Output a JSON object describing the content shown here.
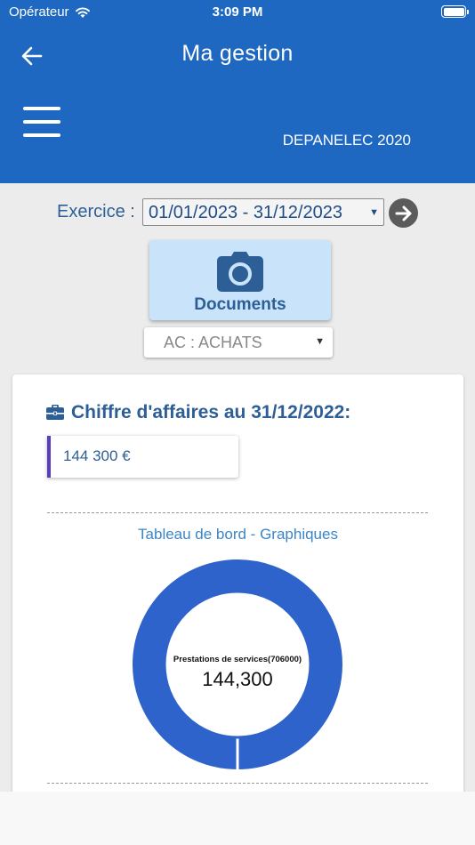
{
  "status_bar": {
    "carrier": "Opérateur",
    "time": "3:09 PM"
  },
  "header": {
    "title": "Ma gestion",
    "company": "DEPANELEC 2020"
  },
  "exercise": {
    "label": "Exercice :",
    "selected": "01/01/2023 - 31/12/2023"
  },
  "documents": {
    "label": "Documents"
  },
  "journal": {
    "selected": "AC : ACHATS"
  },
  "turnover": {
    "title": "Chiffre d'affaires au 31/12/2022:",
    "value": "144 300 €"
  },
  "dashboard": {
    "title": "Tableau de bord - Graphiques"
  },
  "chart_data": {
    "type": "pie",
    "variant": "donut",
    "series": [
      {
        "name": "Prestations de services(706000)",
        "value": 144300
      }
    ],
    "center_label": "Prestations de services(706000)",
    "center_value": "144,300"
  },
  "colors": {
    "primary": "#1e68c2",
    "donut": "#2f63cc",
    "accent": "#2d5f96"
  }
}
